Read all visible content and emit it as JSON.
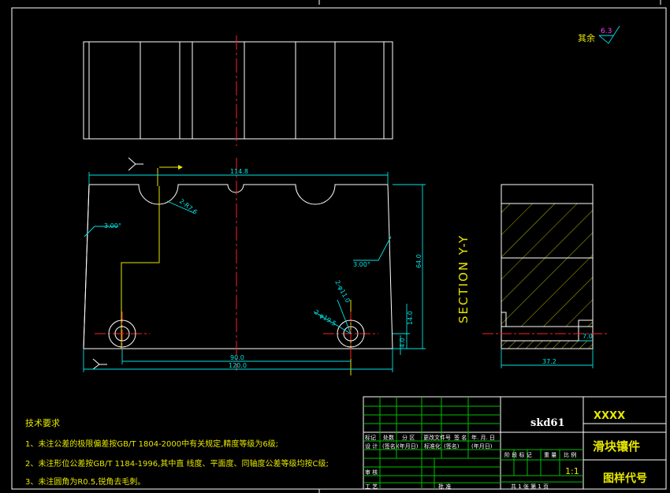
{
  "surface_note": {
    "label": "其余",
    "value": "6.3"
  },
  "dims": {
    "total_width": "114.8",
    "overall_length": "120.0",
    "hole_spacing": "90.0",
    "height": "64.0",
    "hole_height": "14.0",
    "bottom_offset": "4.0",
    "left_angle": "3.00°",
    "right_angle": "3.00°",
    "slot_radius": "2-R7.6",
    "hole_inner": "2-φ11.0",
    "hole_outer": "2-φ19.5",
    "side_width": "37.2",
    "side_step": "7.0"
  },
  "section_label": "SECTION Y-Y",
  "tech": {
    "title": "技术要求",
    "items": [
      "1、未注公差的极限偏差按GB/T 1804-2000中有关规定,精度等级为6级;",
      "2、未注形位公差按GB/T 1184-1996,其中直 线度、平面度、同轴度公差等级均按C级;",
      "3、未注圆角为R0.5,锐角去毛刺。"
    ]
  },
  "title_block": {
    "material": "skd61",
    "company": "XXXX",
    "part_name": "滑块镶件",
    "drawing_no": "图样代号",
    "scale": "1:1",
    "sheet_info": "共 1 张 第 1 页",
    "row1": [
      "标记",
      "处数",
      "分 区",
      "更改文件号",
      "签 名",
      "年. 月. 日"
    ],
    "row2": [
      "设 计",
      "(签名)",
      "(年月日)",
      "标准化",
      "(签名)",
      "(年月日)"
    ],
    "stage_cols": [
      "阶 段 标 记",
      "重 量",
      "比 例"
    ],
    "left_labels": [
      "审 核",
      "工 艺"
    ],
    "approve": "批 准"
  }
}
